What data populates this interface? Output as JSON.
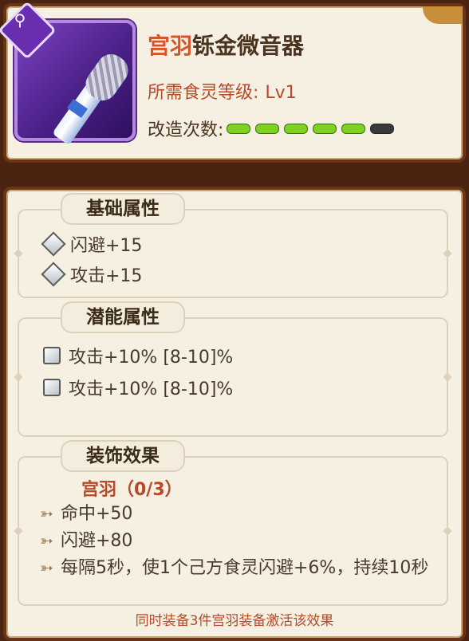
{
  "item": {
    "name_highlight": "宫羽",
    "name_rest": "铄金微音器",
    "requirement_label": "所需食灵等级:",
    "requirement_value": "Lv1",
    "refine_label": "改造次数:",
    "refine_pips": {
      "filled": 5,
      "total": 6
    },
    "badge_icon": "spatula-icon"
  },
  "sections": {
    "basic": {
      "title": "基础属性",
      "stats": [
        "闪避+15",
        "攻击+15"
      ]
    },
    "potential": {
      "title": "潜能属性",
      "stats": [
        "攻击+10% [8-10]%",
        "攻击+10% [8-10]%"
      ]
    },
    "set": {
      "title": "装饰效果",
      "set_name": "宫羽（0/3）",
      "effects": [
        "命中+50",
        "闪避+80",
        "每隔5秒，使1个己方食灵闪避+6%，持续10秒"
      ],
      "footer": "同时装备3件宫羽装备激活该效果"
    }
  },
  "colors": {
    "highlight": "#d9532a",
    "pip_on": "#7ed321",
    "pip_off": "#3a3a3a"
  }
}
